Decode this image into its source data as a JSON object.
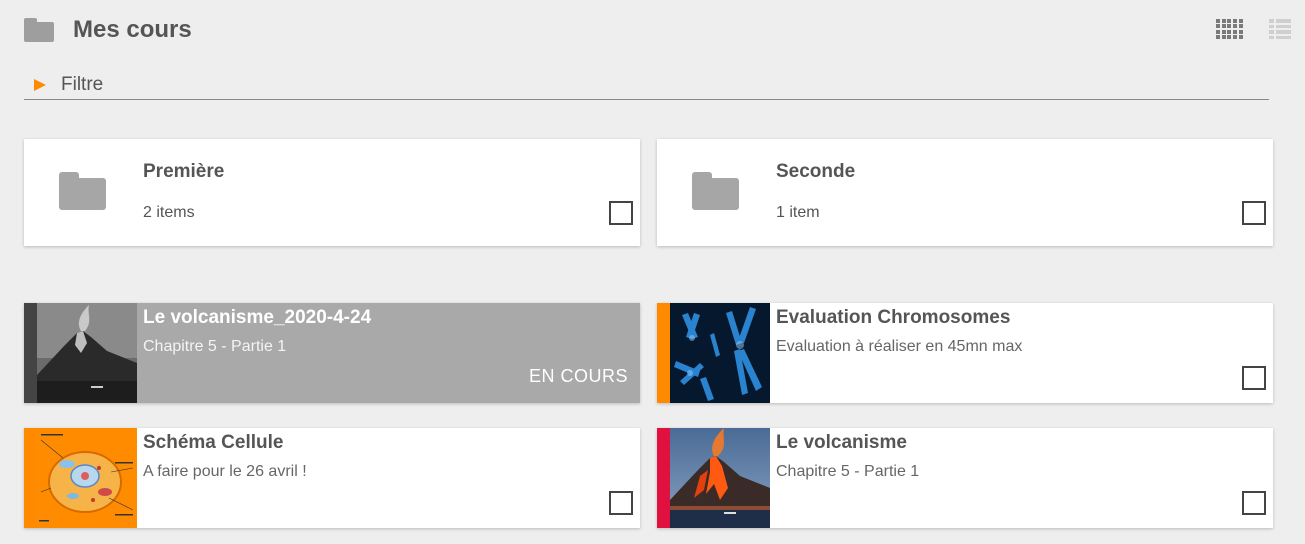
{
  "header": {
    "title": "Mes cours",
    "folder_icon": "folder-icon"
  },
  "view_toggles": {
    "grid_icon": "grid-view-icon",
    "list_icon": "list-view-icon"
  },
  "filter": {
    "label": "Filtre",
    "arrow_color": "#ff8a00"
  },
  "folders": [
    {
      "title": "Première",
      "count": "2 items"
    },
    {
      "title": "Seconde",
      "count": "1 item"
    }
  ],
  "courses": [
    {
      "title": "Le volcanisme_2020-4-24",
      "subtitle": "Chapitre 5 - Partie 1",
      "status": "EN COURS",
      "stripe_color": "#444444",
      "thumbnail": "volcano-grayscale-image"
    },
    {
      "title": "Evaluation Chromosomes",
      "subtitle": "Evaluation à réaliser en 45mn max",
      "stripe_color": "#ff8a00",
      "thumbnail": "chromosomes-image"
    },
    {
      "title": "Schéma Cellule",
      "subtitle": "A faire pour le 26 avril !",
      "stripe_color": "#ff8a00",
      "thumbnail": "cell-diagram-image"
    },
    {
      "title": "Le volcanisme",
      "subtitle": "Chapitre 5 - Partie 1",
      "stripe_color": "#e0103f",
      "thumbnail": "volcano-color-image"
    }
  ]
}
